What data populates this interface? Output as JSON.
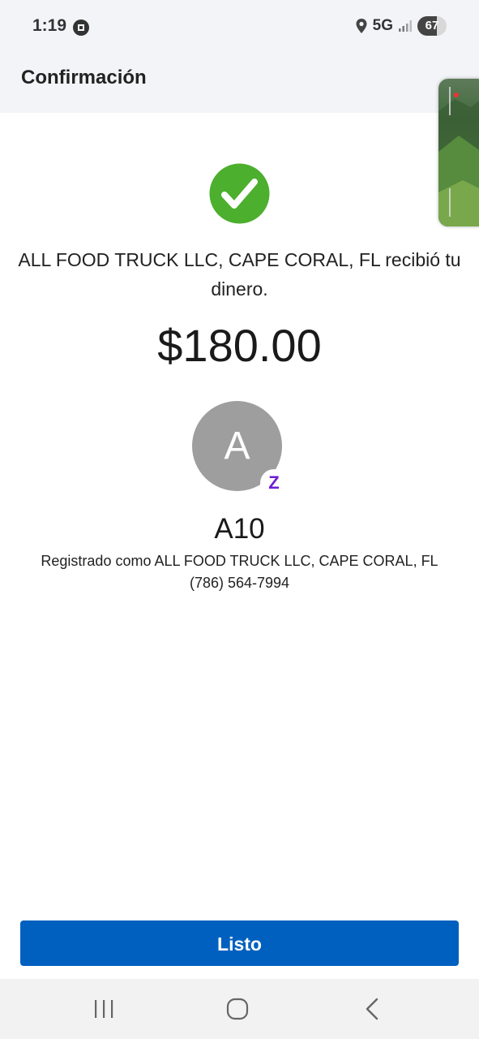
{
  "status_bar": {
    "time": "1:19",
    "network": "5G",
    "battery_level": "67",
    "app_icon": "chase-logo-icon",
    "location_icon": "location-pin-icon",
    "signal_icon": "signal-bars-icon"
  },
  "header": {
    "title": "Confirmación"
  },
  "confirmation": {
    "status_icon": "check-circle-icon",
    "message": "ALL FOOD TRUCK LLC, CAPE CORAL, FL recibió tu dinero.",
    "amount": "$180.00"
  },
  "recipient": {
    "avatar_initial": "A",
    "badge": "Z",
    "badge_icon": "zelle-logo-icon",
    "name": "A10",
    "registered_as": "Registrado como ALL FOOD TRUCK LLC, CAPE CORAL, FL",
    "phone": "(786) 564-7994"
  },
  "actions": {
    "done_label": "Listo"
  },
  "nav": {
    "recents_icon": "recents-icon",
    "home_icon": "home-icon",
    "back_icon": "back-icon"
  },
  "colors": {
    "primary": "#0060bf",
    "success": "#4caf2e",
    "zelle": "#6d1ed4",
    "avatar": "#9e9e9e",
    "header_bg": "#f2f4f7"
  }
}
